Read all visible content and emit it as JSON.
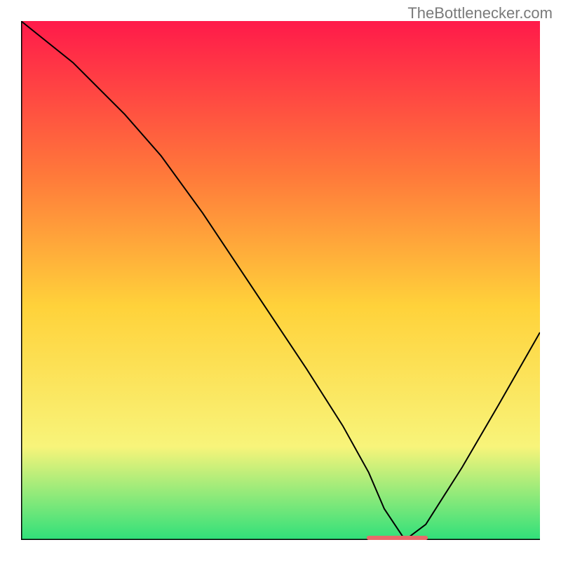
{
  "watermark": "TheBottlenecker.com",
  "chart_data": {
    "type": "line",
    "title": "",
    "xlabel": "",
    "ylabel": "",
    "xlim": [
      0,
      100
    ],
    "ylim": [
      0,
      100
    ],
    "legend": false,
    "grid": false,
    "background_gradient": {
      "top": "#ff1a4a",
      "upper_mid": "#ff7a3a",
      "mid": "#ffd23a",
      "lower_mid": "#f8f47a",
      "bottom": "#2fe07a"
    },
    "series": [
      {
        "name": "bottleneck-curve",
        "color": "#000000",
        "stroke_width": 2,
        "x": [
          0,
          10,
          20,
          27,
          35,
          45,
          55,
          62,
          67,
          70,
          74,
          78,
          85,
          92,
          100
        ],
        "values": [
          100,
          92,
          82,
          74,
          63,
          48,
          33,
          22,
          13,
          6,
          0,
          3,
          14,
          26,
          40
        ]
      }
    ],
    "marker": {
      "name": "optimal-range",
      "color": "#e86a6a",
      "x_start": 67,
      "x_end": 78,
      "y": 0,
      "thickness": 6
    },
    "axes": {
      "left": true,
      "bottom": true,
      "color": "#000000",
      "width": 3
    }
  }
}
